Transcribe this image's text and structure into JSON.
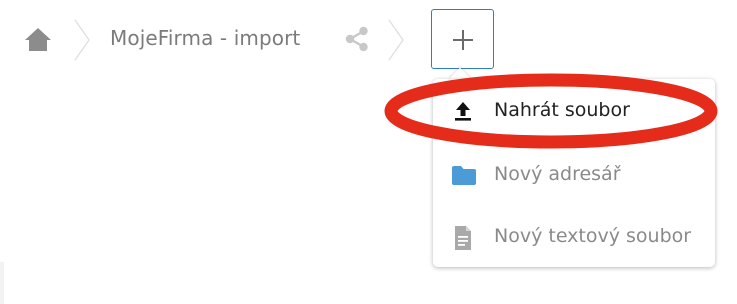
{
  "breadcrumb": {
    "home_icon": "home-icon",
    "separator_icon": "chevron-right-icon",
    "folder_label": "MojeFirma - import",
    "share_icon": "share-icon",
    "new_button_icon": "plus-icon"
  },
  "menu": {
    "items": [
      {
        "label": "Nahrát soubor",
        "icon": "upload-icon"
      },
      {
        "label": "Nový adresář",
        "icon": "folder-icon"
      },
      {
        "label": "Nový textový soubor",
        "icon": "text-file-icon"
      }
    ]
  },
  "colors": {
    "accent": "#2f7fc0",
    "folder": "#4a9bd6",
    "highlight": "#e52b1a",
    "muted_text": "#8a8a8a"
  }
}
